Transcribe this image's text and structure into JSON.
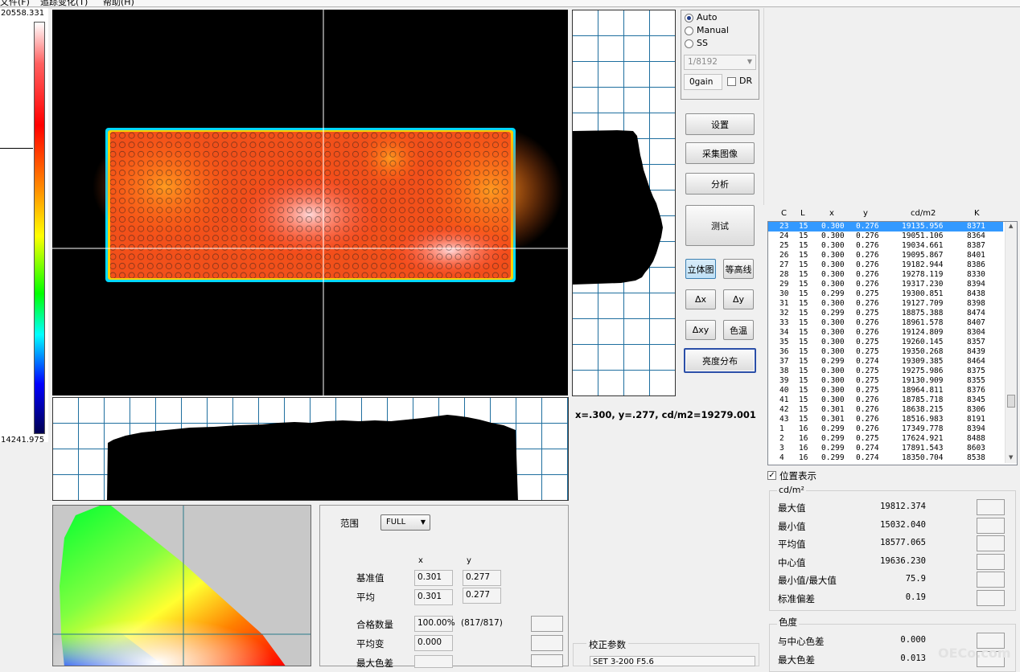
{
  "menu": {
    "items": [
      "文件(F)",
      "追踪变化(T)",
      "帮助(H)"
    ]
  },
  "colorbar": {
    "max_label": "20558.331",
    "min_label": "14241.975"
  },
  "exposure": {
    "modes": [
      {
        "label": "Auto",
        "selected": true
      },
      {
        "label": "Manual",
        "selected": false
      },
      {
        "label": "SS",
        "selected": false
      }
    ],
    "shutter_value": "1/8192",
    "gain_value": "0gain",
    "dr_label": "DR"
  },
  "buttons": {
    "settings": "设置",
    "capture": "采集图像",
    "analyze": "分析",
    "measure": "测试",
    "3d_view": "立体图",
    "contour": "等高线",
    "delta_x": "Δx",
    "delta_y": "Δy",
    "delta_xy": "Δxy",
    "color_temp": "色温",
    "luminance_dist": "亮度分布"
  },
  "cursor_readout": "x=.300, y=.277, cd/m2=19279.001",
  "table": {
    "headers": [
      "C",
      "L",
      "x",
      "y",
      "cd/m2",
      "K"
    ],
    "rows": [
      [
        "23",
        "15",
        "0.300",
        "0.276",
        "19135.956",
        "8371"
      ],
      [
        "24",
        "15",
        "0.300",
        "0.276",
        "19051.106",
        "8364"
      ],
      [
        "25",
        "15",
        "0.300",
        "0.276",
        "19034.661",
        "8387"
      ],
      [
        "26",
        "15",
        "0.300",
        "0.276",
        "19095.867",
        "8401"
      ],
      [
        "27",
        "15",
        "0.300",
        "0.276",
        "19182.944",
        "8386"
      ],
      [
        "28",
        "15",
        "0.300",
        "0.276",
        "19278.119",
        "8330"
      ],
      [
        "29",
        "15",
        "0.300",
        "0.276",
        "19317.230",
        "8394"
      ],
      [
        "30",
        "15",
        "0.299",
        "0.275",
        "19300.851",
        "8438"
      ],
      [
        "31",
        "15",
        "0.300",
        "0.276",
        "19127.709",
        "8398"
      ],
      [
        "32",
        "15",
        "0.299",
        "0.275",
        "18875.388",
        "8474"
      ],
      [
        "33",
        "15",
        "0.300",
        "0.276",
        "18961.578",
        "8407"
      ],
      [
        "34",
        "15",
        "0.300",
        "0.276",
        "19124.809",
        "8304"
      ],
      [
        "35",
        "15",
        "0.300",
        "0.275",
        "19260.145",
        "8357"
      ],
      [
        "36",
        "15",
        "0.300",
        "0.275",
        "19350.268",
        "8439"
      ],
      [
        "37",
        "15",
        "0.299",
        "0.274",
        "19309.385",
        "8464"
      ],
      [
        "38",
        "15",
        "0.300",
        "0.275",
        "19275.986",
        "8375"
      ],
      [
        "39",
        "15",
        "0.300",
        "0.275",
        "19130.909",
        "8355"
      ],
      [
        "40",
        "15",
        "0.300",
        "0.275",
        "18964.811",
        "8376"
      ],
      [
        "41",
        "15",
        "0.300",
        "0.276",
        "18785.718",
        "8345"
      ],
      [
        "42",
        "15",
        "0.301",
        "0.276",
        "18638.215",
        "8306"
      ],
      [
        "43",
        "15",
        "0.301",
        "0.276",
        "18516.983",
        "8191"
      ],
      [
        "1",
        "16",
        "0.299",
        "0.276",
        "17349.778",
        "8394"
      ],
      [
        "2",
        "16",
        "0.299",
        "0.275",
        "17624.921",
        "8488"
      ],
      [
        "3",
        "16",
        "0.299",
        "0.274",
        "17891.543",
        "8603"
      ],
      [
        "4",
        "16",
        "0.299",
        "0.274",
        "18350.704",
        "8538"
      ]
    ]
  },
  "position_display": "位置表示",
  "luminance_stats": {
    "group_label": "cd/m²",
    "items": [
      {
        "label": "最大值",
        "value": "19812.374"
      },
      {
        "label": "最小值",
        "value": "15032.040"
      },
      {
        "label": "平均值",
        "value": "18577.065"
      },
      {
        "label": "中心值",
        "value": "19636.230"
      },
      {
        "label": "最小值/最大值",
        "value": "75.9"
      },
      {
        "label": "标准偏差",
        "value": "0.19"
      }
    ]
  },
  "chroma_stats": {
    "group_label": "色度",
    "items": [
      {
        "label": "与中心色差",
        "value": "0.000"
      },
      {
        "label": "最大色差",
        "value": "0.013"
      }
    ]
  },
  "analysis": {
    "range_label": "范围",
    "range_value": "FULL",
    "col_x": "x",
    "col_y": "y",
    "ref_label": "基准值",
    "ref_x": "0.301",
    "ref_y": "0.277",
    "avg_label": "平均",
    "avg_x": "0.301",
    "avg_y": "0.277",
    "pass_label": "合格数量",
    "pass_value": "100.00%",
    "pass_count": "(817/817)",
    "avg_change_label": "平均变",
    "avg_change_value": "0.000",
    "max_diff_label": "最大色差"
  },
  "calibration": {
    "group_label": "校正参数",
    "value": "SET 3-200 F5.6"
  },
  "watermark": "OECo.com",
  "colors": {
    "accent": "#3399ff",
    "grid": "#1f6f9f",
    "selected_border": "#2b4fa8"
  }
}
